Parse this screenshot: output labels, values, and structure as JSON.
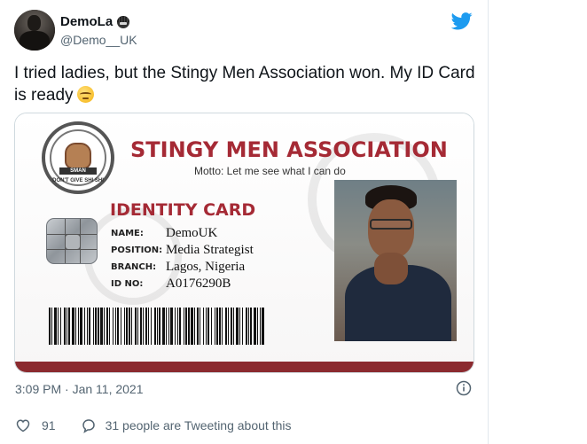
{
  "tweet": {
    "author": {
      "display_name": "DemoLa",
      "handle": "@Demo__UK"
    },
    "text": "I tried ladies, but the Stingy Men Association won. My ID Card is ready",
    "timestamp": "3:09 PM · Jan 11, 2021",
    "likes": "91",
    "discussion": "31 people are Tweeting about this",
    "brand_color": "#1d9bf0"
  },
  "id_card": {
    "seal_band": "SMAN",
    "seal_text": "DON'T GIVE SHI SHI",
    "organization": "STINGY MEN ASSOCIATION",
    "motto": "Motto: Let me see what I can do",
    "card_type": "IDENTITY CARD",
    "fields": [
      {
        "label": "NAME:",
        "value": "DemoUK"
      },
      {
        "label": "POSITION:",
        "value": "Media Strategist"
      },
      {
        "label": "BRANCH:",
        "value": "Lagos, Nigeria"
      },
      {
        "label": "ID NO:",
        "value": "A0176290B"
      }
    ],
    "accent_color": "#a52a35"
  }
}
